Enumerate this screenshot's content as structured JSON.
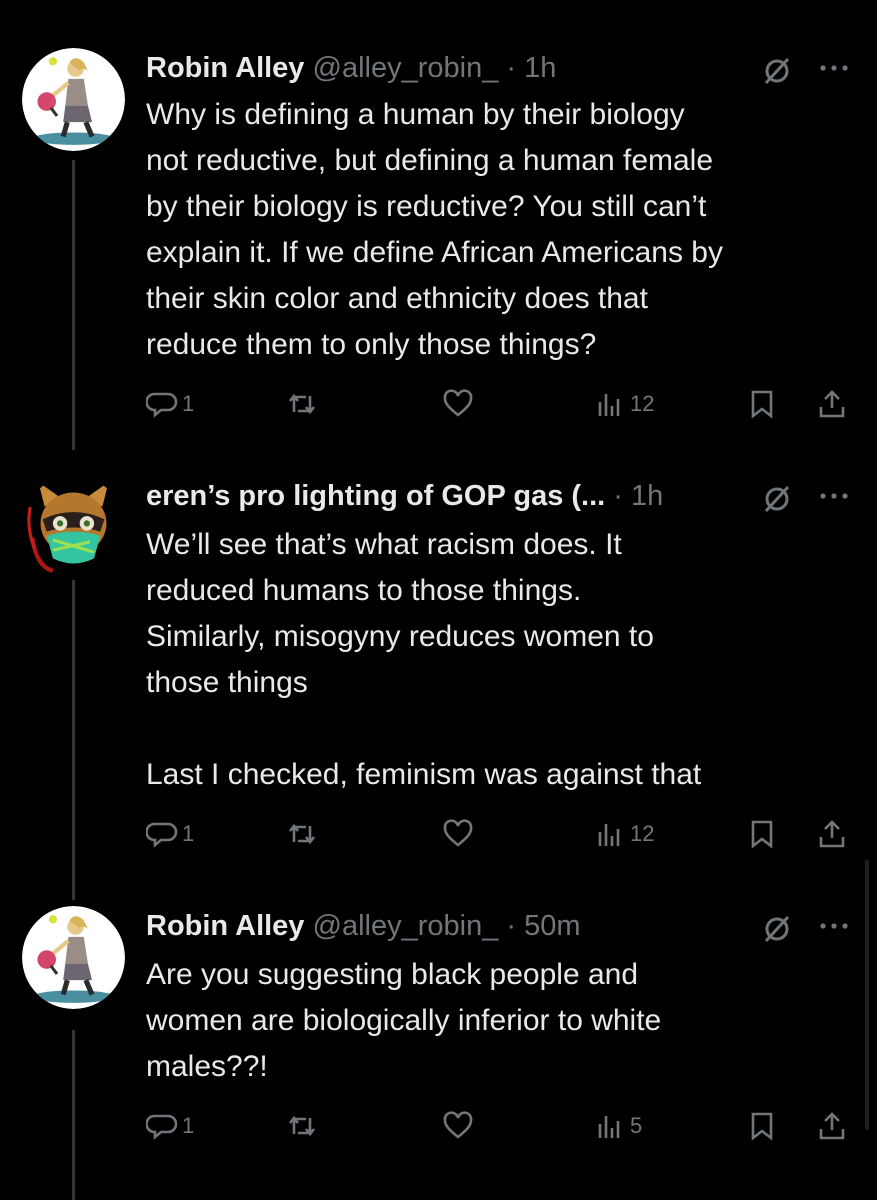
{
  "tweets": [
    {
      "author": "Robin Alley",
      "handle": "@alley_robin_",
      "dot": "·",
      "time": "1h",
      "text": "Why is defining a human by their biology\nnot reductive, but defining a human female\nby their biology is reductive? You still can’t\nexplain it. If we define African Americans by\ntheir skin color and ethnicity does that\nreduce them to only those things?",
      "replies": "1",
      "retweets": "",
      "likes": "",
      "views": "12",
      "avatar": "pickleball-player-avatar"
    },
    {
      "author": "eren’s pro lighting of GOP gas (...",
      "handle": "",
      "dot": "·",
      "time": "1h",
      "text": "We’ll see that’s what racism does. It\nreduced humans to those things.\nSimilarly, misogyny reduces women to\nthose things\n\nLast I checked, feminism was against that",
      "replies": "1",
      "retweets": "",
      "likes": "",
      "views": "12",
      "avatar": "masked-raccoon-avatar"
    },
    {
      "author": "Robin Alley",
      "handle": "@alley_robin_",
      "dot": "·",
      "time": "50m",
      "text": "Are you suggesting black people and\nwomen are biologically inferior to white\nmales??!",
      "replies": "1",
      "retweets": "",
      "likes": "",
      "views": "5",
      "avatar": "pickleball-player-avatar"
    }
  ],
  "icons": {
    "reply": "reply-icon",
    "retweet": "retweet-icon",
    "like": "heart-icon",
    "views": "views-icon",
    "bookmark": "bookmark-icon",
    "share": "share-icon",
    "grok": "grok-icon",
    "more": "more-icon"
  },
  "colors": {
    "background": "#000000",
    "text": "#e7e9ea",
    "secondary": "#71767b",
    "thread_line": "#333639"
  }
}
